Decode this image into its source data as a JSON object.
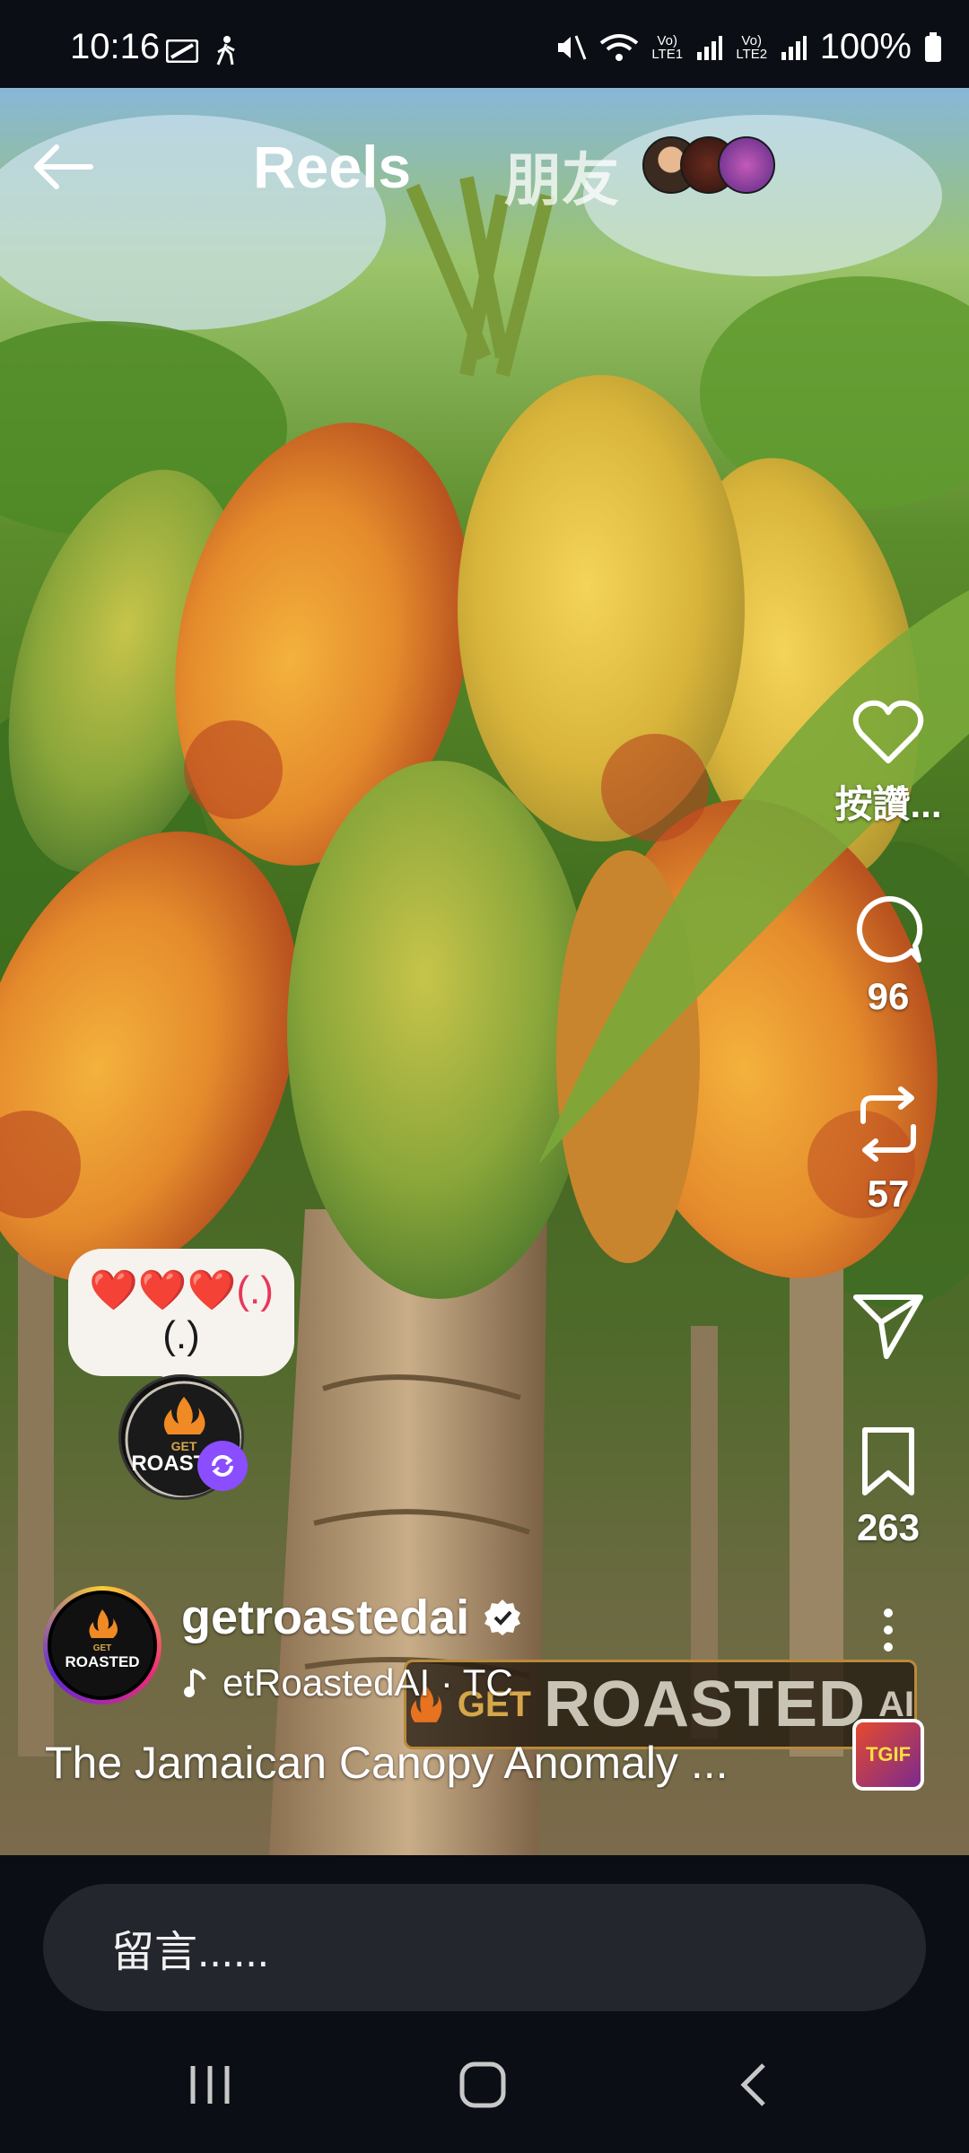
{
  "status_bar": {
    "time": "10:16",
    "battery": "100%",
    "sim1_label": "Vo) LTE1",
    "sim2_label": "Vo) LTE2"
  },
  "header": {
    "tab_reels": "Reels",
    "tab_friends": "朋友"
  },
  "actions": {
    "like_label": "按讚...",
    "comment_count": "96",
    "repost_count": "57",
    "save_count": "263"
  },
  "note": {
    "text_line1": "❤️❤️❤️(.)",
    "text_line2": "(.)"
  },
  "post": {
    "username": "getroastedai",
    "music": "etRoastedAI · TC",
    "caption": "The Jamaican Canopy Anomaly ...",
    "audio_thumb_label": "TGIF"
  },
  "watermark": {
    "get": "GET",
    "roasted": "ROASTED",
    "ai": "AI"
  },
  "logo_text": {
    "get": "GET",
    "roasted": "ROASTED"
  },
  "comment_bar": {
    "placeholder": "留言......"
  },
  "icons": {
    "back": "arrow-left-icon",
    "like": "heart-icon",
    "comment": "speech-bubble-icon",
    "repost": "repost-icon",
    "share": "send-icon",
    "save": "bookmark-icon",
    "more": "more-vertical-icon",
    "verified": "verified-badge-icon",
    "music": "music-note-icon"
  },
  "colors": {
    "background": "#0b0e14",
    "comment_input_bg": "#24262e",
    "story_ring_start": "#f9ce34",
    "story_ring_mid": "#ee2a7b",
    "repost_badge": "#8a4dff"
  }
}
